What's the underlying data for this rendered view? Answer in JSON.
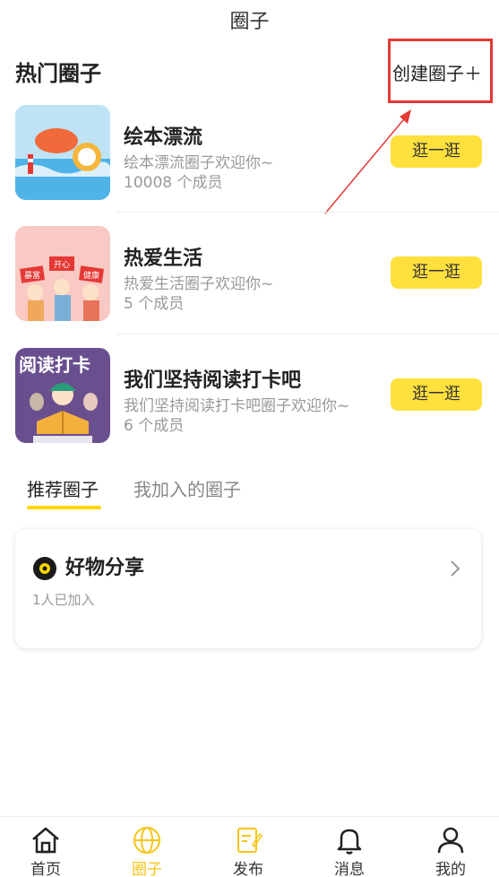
{
  "header": {
    "title": "圈子"
  },
  "hot": {
    "title": "热门圈子",
    "create_label": "创建圈子＋",
    "circles": [
      {
        "name": "绘本漂流",
        "desc": "绘本漂流圈子欢迎你~",
        "members": "10008 个成员",
        "button": "逛一逛"
      },
      {
        "name": "热爱生活",
        "desc": "热爱生活圈子欢迎你~",
        "members": "5 个成员",
        "button": "逛一逛"
      },
      {
        "name": "我们坚持阅读打卡吧",
        "desc": "我们坚持阅读打卡吧圈子欢迎你~",
        "members": "6 个成员",
        "button": "逛一逛"
      }
    ],
    "thumb_text": {
      "reading": "阅读打卡",
      "life_left": "暴富",
      "life_mid": "开心",
      "life_right": "健康"
    }
  },
  "tabs": [
    {
      "label": "推荐圈子",
      "active": true
    },
    {
      "label": "我加入的圈子",
      "active": false
    }
  ],
  "recommend_card": {
    "title": "好物分享",
    "subtitle": "1人已加入"
  },
  "bottom_nav": [
    {
      "label": "首页",
      "icon": "home-icon",
      "active": false
    },
    {
      "label": "圈子",
      "icon": "globe-icon",
      "active": true
    },
    {
      "label": "发布",
      "icon": "edit-icon",
      "active": false
    },
    {
      "label": "消息",
      "icon": "bell-icon",
      "active": false
    },
    {
      "label": "我的",
      "icon": "user-icon",
      "active": false
    }
  ],
  "colors": {
    "accent": "#ffe03d",
    "active_nav": "#f5c518",
    "annotation": "#e53935"
  }
}
